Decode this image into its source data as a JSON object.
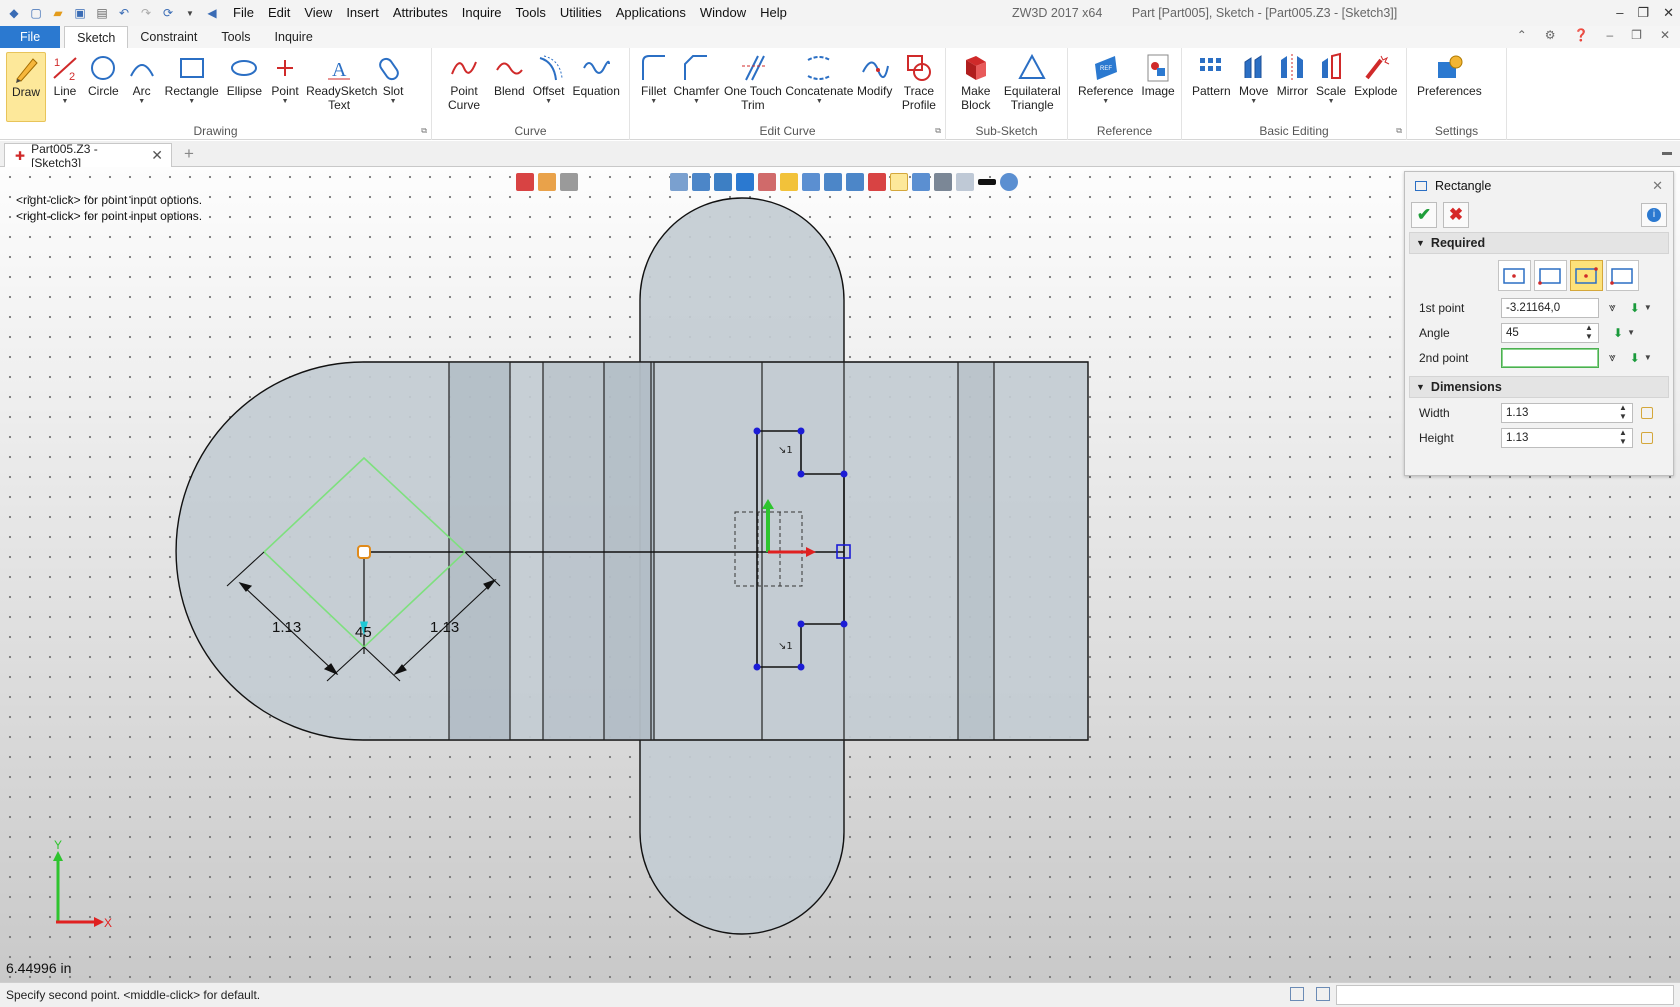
{
  "titlebar": {
    "menus": [
      "File",
      "Edit",
      "View",
      "Insert",
      "Attributes",
      "Inquire",
      "Tools",
      "Utilities",
      "Applications",
      "Window",
      "Help"
    ],
    "app": "ZW3D 2017  x64",
    "part": "Part [Part005],",
    "sketch": "Sketch - [Part005.Z3 - [Sketch3]]"
  },
  "ribbon_tabs": [
    "File",
    "Sketch",
    "Constraint",
    "Tools",
    "Inquire"
  ],
  "ribbon": {
    "drawing": {
      "name": "Drawing",
      "buttons": [
        "Draw",
        "Line",
        "Circle",
        "Arc",
        "Rectangle",
        "Ellipse",
        "Point",
        "ReadySketch Text",
        "Slot"
      ]
    },
    "curve": {
      "name": "Curve",
      "buttons": [
        "Point Curve",
        "Blend",
        "Offset",
        "Equation"
      ]
    },
    "edit": {
      "name": "Edit Curve",
      "buttons": [
        "Fillet",
        "Chamfer",
        "One Touch Trim",
        "Concatenate",
        "Modify",
        "Trace Profile"
      ]
    },
    "sub": {
      "name": "Sub-Sketch",
      "buttons": [
        "Make Block",
        "Equilateral Triangle"
      ]
    },
    "ref": {
      "name": "Reference",
      "buttons": [
        "Reference",
        "Image"
      ]
    },
    "basic": {
      "name": "Basic Editing",
      "buttons": [
        "Pattern",
        "Move",
        "Mirror",
        "Scale",
        "Explode"
      ]
    },
    "settings": {
      "name": "Settings",
      "buttons": [
        "Preferences"
      ]
    }
  },
  "doc_tab": {
    "label": "Part005.Z3 - [Sketch3]"
  },
  "canvas": {
    "hints": [
      "<right-click> for point input options.",
      "<right-click> for point input options."
    ],
    "dim_left": "1.13",
    "dim_right": "1.13",
    "angle": "45",
    "scale": "6.44996 in",
    "axis_x": "X",
    "axis_y": "Y"
  },
  "panel": {
    "title": "Rectangle",
    "required": "Required",
    "first_point_label": "1st point",
    "first_point_value": "-3.21164,0",
    "angle_label": "Angle",
    "angle_value": "45",
    "second_point_label": "2nd point",
    "second_point_value": "",
    "dimensions": "Dimensions",
    "width_label": "Width",
    "width_value": "1.13",
    "height_label": "Height",
    "height_value": "1.13"
  },
  "status": {
    "prompt": "Specify second point.  <middle-click> for default."
  },
  "colors": {
    "accent": "#2b79d0",
    "highlight": "#fde89a",
    "sketch_preview": "#7ee07e",
    "part_fill": "#c3ccd3"
  }
}
